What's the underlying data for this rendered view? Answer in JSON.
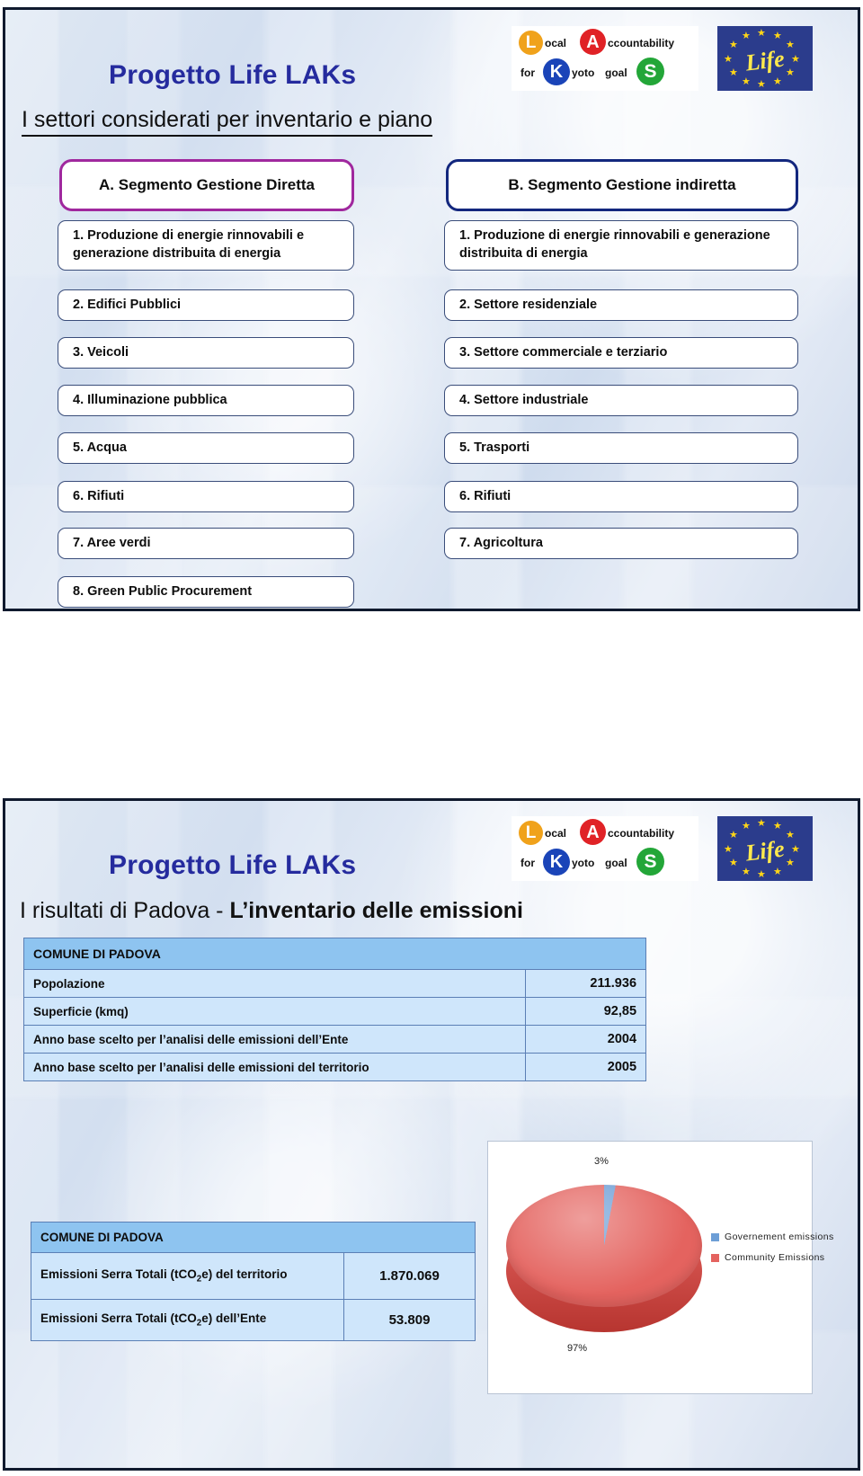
{
  "brand": {
    "project_title": "Progetto Life LAKs",
    "lak_logo": {
      "l": "L",
      "local": "ocal",
      "a": "A",
      "accountability": "ccountability",
      "for": "for",
      "k": "K",
      "kyoto": "yoto",
      "goal": "goal",
      "s": "S"
    },
    "eu_logo": {
      "word": "Life"
    },
    "colors": {
      "brand_blue": "#252b9e",
      "logo_orange": "#F0A21B",
      "logo_red": "#E02226",
      "logo_blue": "#1A44B8",
      "logo_green": "#23A638",
      "eu_blue": "#2b3c8c",
      "eu_yellow": "#ffd617"
    }
  },
  "slide1": {
    "title": "Progetto Life LAKs",
    "subtitle": "I settori considerati per inventario e piano",
    "segment_a": {
      "header": "A. Segmento Gestione Diretta",
      "border_color": "#a0289e",
      "items": [
        "1. Produzione di energie rinnovabili e generazione distribuita di energia",
        "2. Edifici Pubblici",
        "3. Veicoli",
        "4. Illuminazione pubblica",
        "5. Acqua",
        "6. Rifiuti",
        "7. Aree verdi",
        "8. Green Public Procurement"
      ]
    },
    "segment_b": {
      "header": "B. Segmento Gestione indiretta",
      "border_color": "#13277e",
      "items": [
        "1. Produzione di energie rinnovabili e generazione distribuita di energia",
        "2. Settore residenziale",
        "3. Settore commerciale e terziario",
        "4. Settore industriale",
        "5. Trasporti",
        "6. Rifiuti",
        "7. Agricoltura"
      ]
    }
  },
  "slide2": {
    "title": "Progetto Life LAKs",
    "subtitle_light": "I risultati di Padova - ",
    "subtitle_bold": "L’inventario delle emissioni",
    "table_main": {
      "header": "COMUNE DI PADOVA",
      "rows": [
        {
          "label": "Popolazione",
          "value": "211.936"
        },
        {
          "label": "Superficie (kmq)",
          "value": "92,85"
        },
        {
          "label": "Anno base scelto per l’analisi delle emissioni dell’Ente",
          "value": "2004"
        },
        {
          "label": "Anno base scelto per l’analisi delle emissioni del territorio",
          "value": "2005"
        }
      ]
    },
    "table_emissions": {
      "header": "COMUNE DI PADOVA",
      "rows": [
        {
          "label_pre": "Emissioni Serra Totali (tCO",
          "label_sub": "2",
          "label_post": "e) del territorio",
          "value": "1.870.069"
        },
        {
          "label_pre": "Emissioni Serra Totali (tCO",
          "label_sub": "2",
          "label_post": "e) dell’Ente",
          "value": "53.809"
        }
      ]
    },
    "chart_data": {
      "type": "pie",
      "title": "",
      "categories": [
        "Governement emissions",
        "Community Emissions"
      ],
      "values": [
        3,
        97
      ],
      "data_labels": [
        "3%",
        "97%"
      ],
      "colors": [
        "#6d9ed6",
        "#e4635f"
      ],
      "legend_position": "right",
      "grid": false,
      "three_d": true,
      "legend": [
        {
          "label": "Governement emissions",
          "color": "#6d9ed6"
        },
        {
          "label": "Community Emissions",
          "color": "#e4635f"
        }
      ]
    }
  }
}
